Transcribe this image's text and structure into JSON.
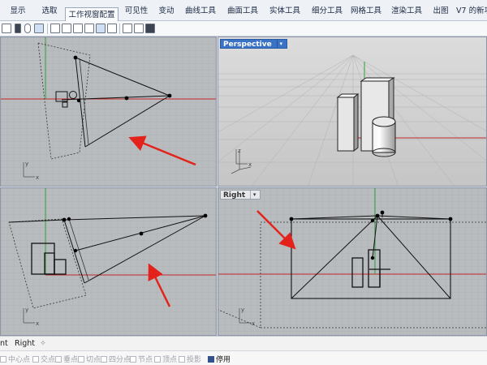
{
  "ribbon_tabs": [
    "显示",
    "选取",
    "工作视窗配置",
    "可见性",
    "变动",
    "曲线工具",
    "曲面工具",
    "实体工具",
    "细分工具",
    "网格工具",
    "渲染工具",
    "出图",
    "V7 的新功"
  ],
  "active_tab": "工作视窗配置",
  "viewports": {
    "top_left": {
      "label": ""
    },
    "perspective": {
      "label": "Perspective",
      "arrow": "▾"
    },
    "bottom_left": {
      "label": ""
    },
    "right": {
      "label": "Right",
      "arrow": "▾"
    }
  },
  "axis_labels": {
    "x": "x",
    "y": "y",
    "z": "z"
  },
  "viewport_tabs": {
    "partial": "nt",
    "right": "Right",
    "add": "✧"
  },
  "osnaps": [
    {
      "label": "中心点",
      "checked": false
    },
    {
      "label": "交点",
      "checked": false
    },
    {
      "label": "垂点",
      "checked": false
    },
    {
      "label": "切点",
      "checked": false
    },
    {
      "label": "四分点",
      "checked": false
    },
    {
      "label": "节点",
      "checked": false
    },
    {
      "label": "顶点",
      "checked": false
    },
    {
      "label": "投影",
      "checked": false
    },
    {
      "label": "停用",
      "checked": true
    }
  ],
  "colors": {
    "viewport_bg": "#b9bcbf",
    "grid": "#a4a8ac",
    "x_axis": "#c0282a",
    "y_axis": "#2f9f3a",
    "arrow": "#e3231b",
    "active_label": "#3a73c6"
  }
}
